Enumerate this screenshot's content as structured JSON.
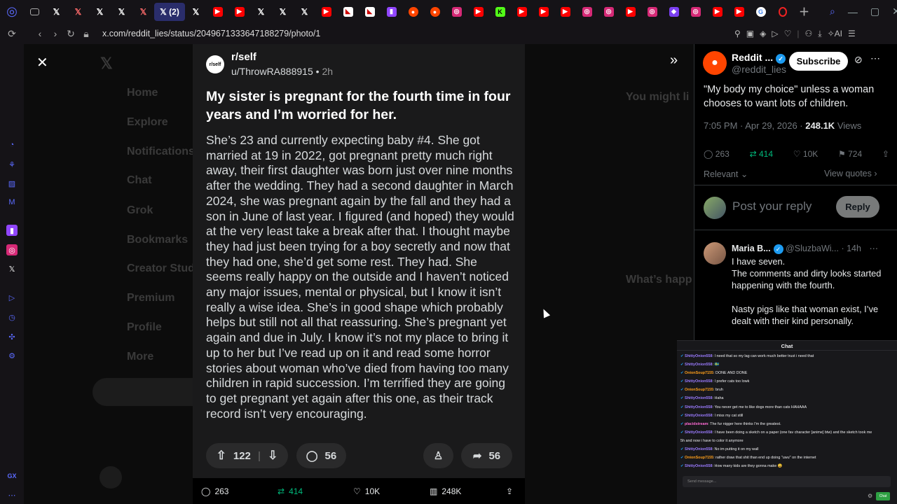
{
  "browser": {
    "active_tab_label": "(2)",
    "url": "x.com/reddit_lies/status/2049671333647188279/photo/1"
  },
  "post": {
    "subreddit": "r/self",
    "sub_avatar_text": "r/self",
    "username": "u/ThrowRA888915",
    "age": "2h",
    "title": "My sister is pregnant for the fourth time in four years and I’m worried for her.",
    "body": "She’s 23 and currently expecting baby #4. She got married at 19 in 2022, got pregnant pretty much right away, their first daughter was born just over nine months after the wedding. They had a second daughter in March 2024, she was pregnant again by the fall and they had a son in June of last year. I figured (and hoped) they would at the very least take a break after that. I thought maybe they had just been trying for a boy secretly and now that they had one, she’d get some rest. They had. She seems really happy on the outside and I haven’t noticed any major issues, mental or physical, but I know it isn’t really a wise idea. She’s in good shape which probably helps but still not all that reassuring. She’s pregnant yet again and due in July. I know it’s not my place to bring it up to her but I’ve read up on it and read some horror stories about woman who’ve died from having too many children in rapid succession. I’m terrified they are going to get pregnant yet again after this one, as their track record isn’t very encouraging.",
    "upvotes": "122",
    "comments": "56",
    "shares": "56"
  },
  "photo_bar": {
    "replies": "263",
    "reposts": "414",
    "likes": "10K",
    "views": "248K"
  },
  "tweet": {
    "account_name": "Reddit ...",
    "handle": "@reddit_lies",
    "subscribe_label": "Subscribe",
    "text": "\"My body my choice\" unless a woman chooses to want lots of children.",
    "time": "7:05 PM · Apr 29, 2026 ·",
    "views_count": "248.1K",
    "views_label": "Views",
    "replies": "263",
    "reposts": "414",
    "likes": "10K",
    "bookmarks": "724",
    "sort_label": "Relevant",
    "view_quotes": "View quotes",
    "reply_placeholder": "Post your reply",
    "reply_button": "Reply"
  },
  "comment": {
    "name": "Maria B...",
    "handle": "@SluzbaWi...",
    "age": "· 14h",
    "line1": "I have seven.",
    "line2": "The comments and dirty looks started happening with the fourth.",
    "line3": "Nasty pigs like that woman exist, I’ve dealt with their kind personally."
  },
  "background_sidebar": [
    "Home",
    "Explore",
    "Notifications",
    "Chat",
    "Grok",
    "Bookmarks",
    "Creator Studio",
    "Premium",
    "Profile",
    "More"
  ],
  "background_right": {
    "you_might_like": "You might li",
    "whats_happening": "What’s happ"
  },
  "chat": {
    "title": "Chat",
    "input_placeholder": "Send message...",
    "send_label": "Chat",
    "messages": [
      {
        "user": "ShittyOnion558",
        "text": ": I need that so my lag can work much better trust i need that",
        "color": "#9b7bff"
      },
      {
        "user": "ShittyOnion558",
        "text": ": 🇸🇪",
        "color": "#9b7bff"
      },
      {
        "user": "OnionSoup7155",
        "text": ": DONE AND DONE",
        "color": "#ff9f1a"
      },
      {
        "user": "ShittyOnion558",
        "text": ": I prefer cats too lowk",
        "color": "#9b7bff"
      },
      {
        "user": "OnionSoup7155",
        "text": ": bruh",
        "color": "#ff9f1a"
      },
      {
        "user": "ShittyOnion558",
        "text": ": Haha",
        "color": "#9b7bff"
      },
      {
        "user": "ShittyOnion558",
        "text": ": You never get me to like dogs more than cats HAHAAA",
        "color": "#9b7bff"
      },
      {
        "user": "ShittyOnion558",
        "text": ": I miss my cat still",
        "color": "#9b7bff"
      },
      {
        "user": "placidstream",
        "text": ": The fur nigger here thinks I'm the greatest.",
        "color": "#ff6bd5"
      },
      {
        "user": "ShittyOnion558",
        "text": ": I have been doing a sketch on a paper (one fav character [anime] btw) and the sketch took me",
        "color": "#9b7bff"
      },
      {
        "user": "",
        "text": "5h and now i have to color it anymore",
        "color": "#efeff1"
      },
      {
        "user": "ShittyOnion558",
        "text": ": No im putting it on my wall",
        "color": "#9b7bff"
      },
      {
        "user": "OnionSoup7155",
        "text": ": rather draw that shit than end up doing \"uwu\" on the internet",
        "color": "#ff9f1a"
      },
      {
        "user": "ShittyOnion558",
        "text": ": How many kids are they gonna make 😄",
        "color": "#9b7bff"
      }
    ]
  }
}
